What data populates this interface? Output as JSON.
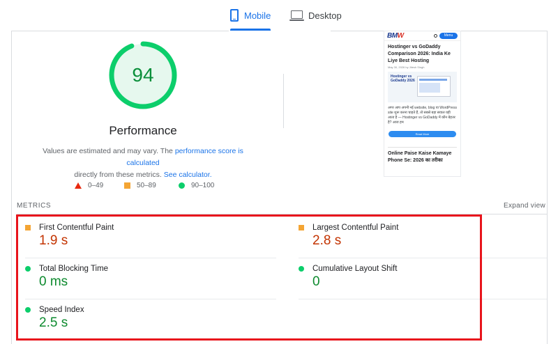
{
  "tabs": [
    {
      "label": "Mobile",
      "icon": "phone-icon",
      "active": true
    },
    {
      "label": "Desktop",
      "icon": "laptop-icon",
      "active": false
    }
  ],
  "score": {
    "value": "94",
    "title": "Performance",
    "note_part1": "Values are estimated and may vary. The ",
    "note_link1": "performance score is calculated",
    "note_part2": "directly from these metrics. ",
    "note_link2": "See calculator."
  },
  "legend": [
    {
      "label": "0–49",
      "color": "#e8290f",
      "shape": "triangle"
    },
    {
      "label": "50–89",
      "color": "#f4a534",
      "shape": "square"
    },
    {
      "label": "90–100",
      "color": "#0cce6b",
      "shape": "circle"
    }
  ],
  "preview": {
    "logo_main": "BM",
    "logo_accent": "W",
    "menu_label": "Menu",
    "post_title": "Hostinger vs GoDaddy Comparison 2026: India Ke Liye Best Hosting",
    "post_meta": "May 30, 2026 by Jitesh Singh",
    "thumb_caption": "Hostinger vs GoDaddy 2026",
    "excerpt": "अगर आप अपनी नई website, blog या WordPress site शुरू करना चाहते हैं, तो सबसे बड़ा सवाल यही आता है — Hostinger vs GoDaddy में कौन बेहतर है? आज हम",
    "button_label": "Read More",
    "next_title": "Online Paise Kaise Kamaye Phone Se: 2026 का तरीका"
  },
  "metrics_section": {
    "label": "METRICS",
    "expand_label": "Expand view"
  },
  "metrics": [
    {
      "name": "First Contentful Paint",
      "value": "1.9 s",
      "rating": "average",
      "color": "#f4a534"
    },
    {
      "name": "Largest Contentful Paint",
      "value": "2.8 s",
      "rating": "average",
      "color": "#f4a534"
    },
    {
      "name": "Total Blocking Time",
      "value": "0 ms",
      "rating": "good",
      "color": "#0cce6b"
    },
    {
      "name": "Cumulative Layout Shift",
      "value": "0",
      "rating": "good",
      "color": "#0cce6b"
    },
    {
      "name": "Speed Index",
      "value": "2.5 s",
      "rating": "good",
      "color": "#0cce6b"
    }
  ],
  "colors": {
    "accent": "#1a73e8",
    "good": "#0cce6b",
    "average": "#f4a534",
    "poor": "#e8290f",
    "highlight": "#e8141c"
  }
}
